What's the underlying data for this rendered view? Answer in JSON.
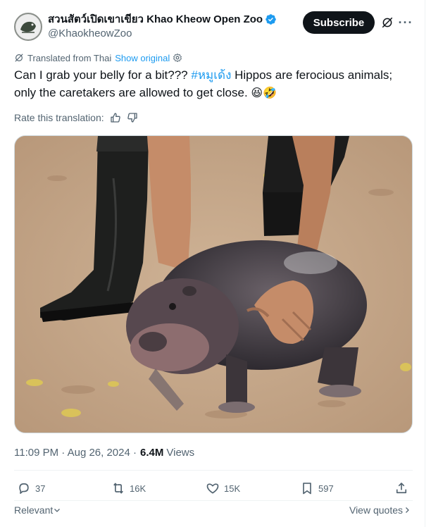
{
  "account": {
    "display_name": "สวนสัตว์เปิดเขาเขียว Khao Kheow Open Zoo",
    "handle": "@KhaokheowZoo",
    "subscribe_label": "Subscribe",
    "more_label": "···"
  },
  "translation": {
    "translated_from": "Translated from Thai",
    "show_original": "Show original",
    "rate_label": "Rate this translation:"
  },
  "tweet": {
    "text_before": "Can I grab your belly for a bit??? ",
    "hashtag": "#หมูเด้ง",
    "text_after": " Hippos are ferocious animals; only the caretakers are allowed to get close. ",
    "emojis": "😆🤣"
  },
  "meta": {
    "time": "11:09 PM · Aug 26, 2024 · ",
    "views_count": "6.4M",
    "views_label": "Views"
  },
  "actions": {
    "replies": "37",
    "reposts": "16K",
    "likes": "15K",
    "bookmarks": "597"
  },
  "footer": {
    "relevant_label": "Relevant",
    "view_quotes_label": "View quotes"
  },
  "colors": {
    "accent": "#1d9bf0",
    "text_primary": "#0f1419",
    "text_secondary": "#536471",
    "verified": "#1d9bf0"
  }
}
